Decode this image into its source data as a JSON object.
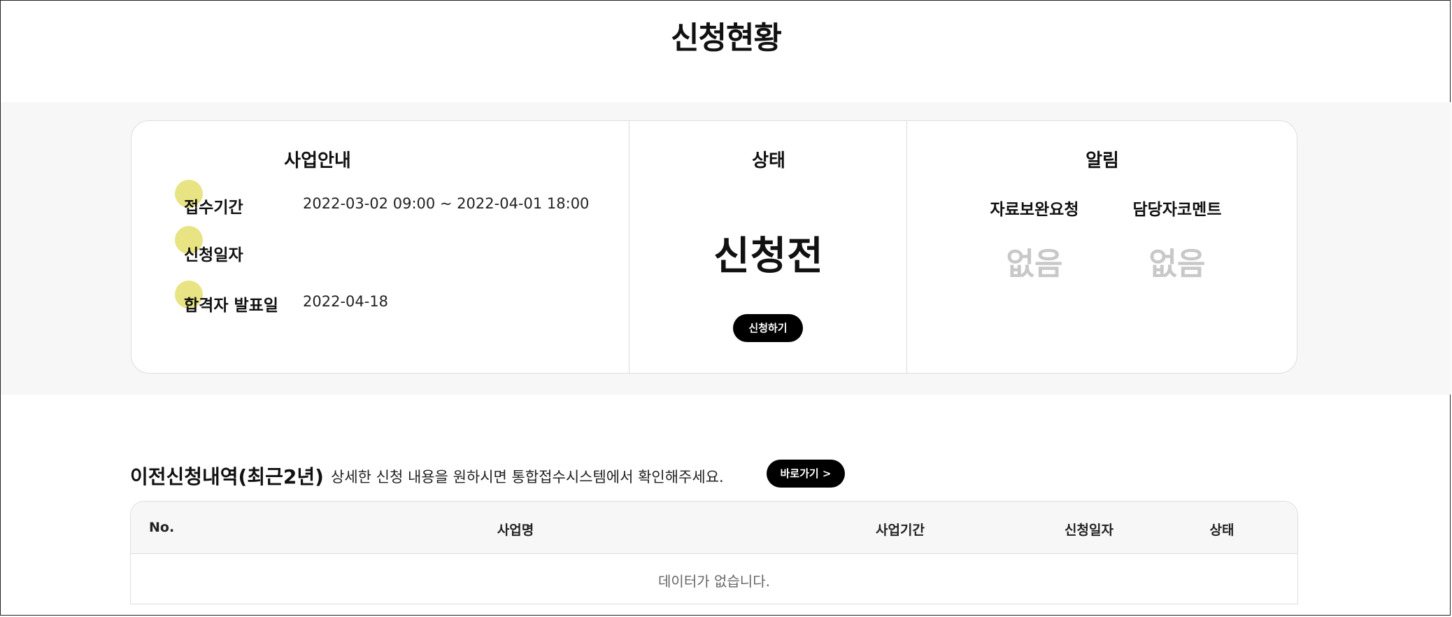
{
  "page": {
    "title": "신청현황"
  },
  "business_info": {
    "heading": "사업안내",
    "rows": [
      {
        "label": "접수기간",
        "value": "2022-03-02 09:00 ~ 2022-04-01 18:00"
      },
      {
        "label": "신청일자",
        "value": ""
      },
      {
        "label": "합격자 발표일",
        "value": "2022-04-18"
      }
    ]
  },
  "status": {
    "heading": "상태",
    "value": "신청전",
    "apply_button_label": "신청하기"
  },
  "alerts": {
    "heading": "알림",
    "items": [
      {
        "label": "자료보완요청",
        "value": "없음"
      },
      {
        "label": "담당자코멘트",
        "value": "없음"
      }
    ]
  },
  "history": {
    "title": "이전신청내역(최근2년)",
    "description": "상세한 신청 내용을 원하시면 통합접수시스템에서 확인해주세요.",
    "goto_button_label": "바로가기 >",
    "columns": [
      "No.",
      "사업명",
      "사업기간",
      "신청일자",
      "상태"
    ],
    "empty_message": "데이터가 없습니다."
  },
  "colors": {
    "accent": "#000000",
    "band_background": "#f7f7f7",
    "muted_value": "#c8c8c8",
    "highlight": "#ded850"
  }
}
